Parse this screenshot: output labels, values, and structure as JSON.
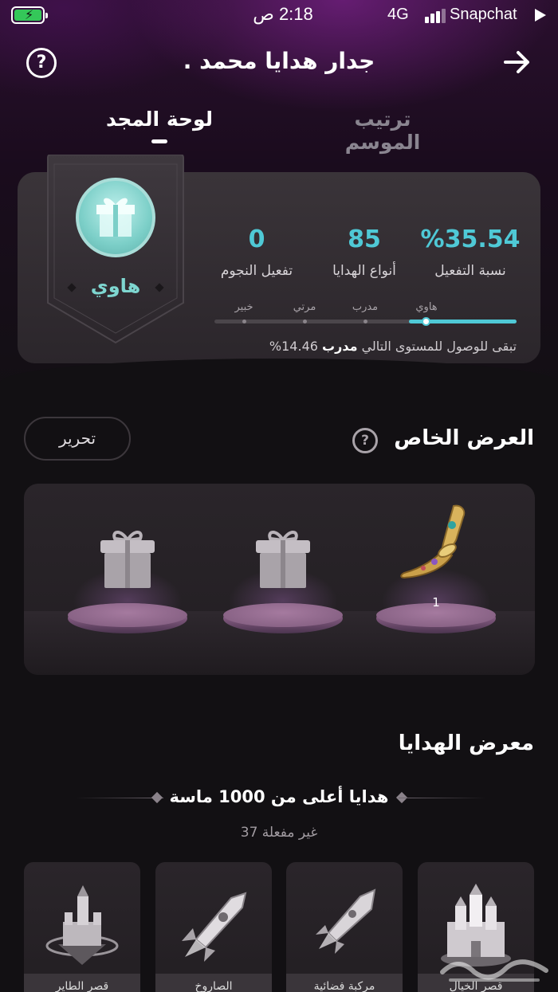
{
  "status_bar": {
    "time": "2:18 ص",
    "network": "4G",
    "app": "Snapchat"
  },
  "header": {
    "title": "جدار هدايا محمد ."
  },
  "tabs": [
    {
      "label": "لوحة المجد",
      "active": true
    },
    {
      "label": "ترتيب الموسم",
      "active": false
    }
  ],
  "rank": {
    "badge_name": "هاوي",
    "stats": [
      {
        "value": "%35.54",
        "label": "نسبة التفعيل"
      },
      {
        "value": "85",
        "label": "أنواع الهدايا"
      },
      {
        "value": "0",
        "label": "تفعيل النجوم"
      }
    ],
    "levels": [
      "هاوي",
      "مدرب",
      "مرتي",
      "خبير"
    ],
    "note_prefix": "تبقى للوصول للمستوى التالي",
    "note_level": "مدرب",
    "note_value": "14.46%",
    "accent": "#4fc9d6"
  },
  "special_offer": {
    "title": "العرض الخاص",
    "edit_label": "تحرير",
    "slots": [
      {
        "item": "dagger-icon",
        "count": "1"
      },
      {
        "item": "gift-box-icon",
        "count": ""
      },
      {
        "item": "gift-box-icon",
        "count": ""
      }
    ]
  },
  "gallery": {
    "title": "معرض الهدايا",
    "tier_title": "هدايا أعلى من 1000 ماسة",
    "tier_subtitle": "غير مفعلة 37",
    "cards": [
      {
        "label": "قصر الخيال",
        "icon": "castle-icon"
      },
      {
        "label": "مركبة فضائية",
        "icon": "rocket-icon"
      },
      {
        "label": "الصاروخ",
        "icon": "rocket-icon"
      },
      {
        "label": "قصر الطاير",
        "icon": "floating-castle-icon"
      }
    ]
  }
}
